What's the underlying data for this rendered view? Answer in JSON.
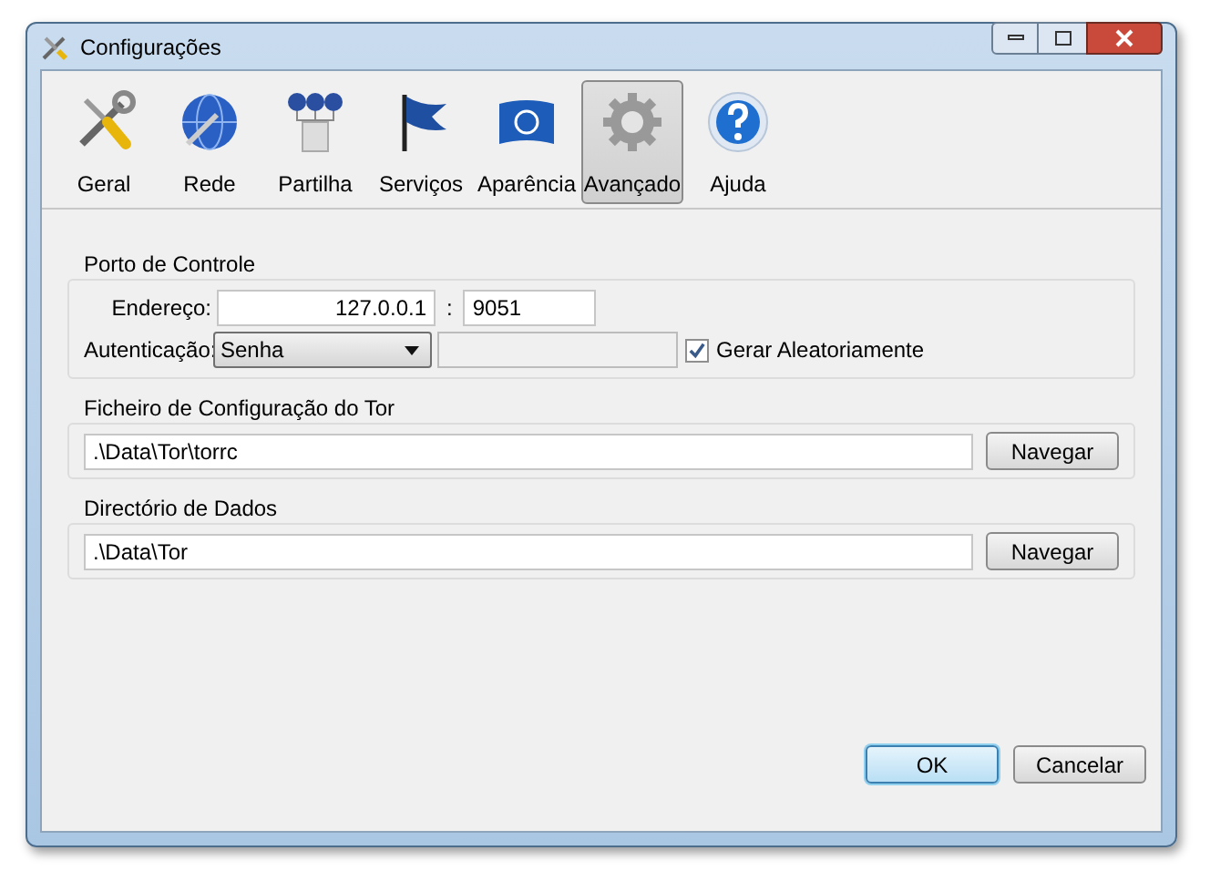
{
  "window": {
    "title": "Configurações"
  },
  "tabs": [
    {
      "label": "Geral",
      "selected": false
    },
    {
      "label": "Rede",
      "selected": false
    },
    {
      "label": "Partilha",
      "selected": false
    },
    {
      "label": "Serviços",
      "selected": false
    },
    {
      "label": "Aparência",
      "selected": false
    },
    {
      "label": "Avançado",
      "selected": true
    },
    {
      "label": "Ajuda",
      "selected": false
    }
  ],
  "control_port": {
    "title": "Porto de Controle",
    "address_label": "Endereço:",
    "address": "127.0.0.1",
    "separator": ":",
    "port": "9051",
    "auth_label": "Autenticação:",
    "auth": "Senha",
    "password_disabled": true,
    "random_label": "Gerar Aleatoriamente",
    "random_checked": true
  },
  "tor_config": {
    "title": "Ficheiro de Configuração do Tor",
    "path": ".\\Data\\Tor\\torrc",
    "browse": "Navegar"
  },
  "data_dir": {
    "title": "Directório de Dados",
    "path": ".\\Data\\Tor",
    "browse": "Navegar"
  },
  "buttons": [
    {
      "label": "OK",
      "kind": "default"
    },
    {
      "label": "Cancelar",
      "kind": "normal"
    }
  ]
}
